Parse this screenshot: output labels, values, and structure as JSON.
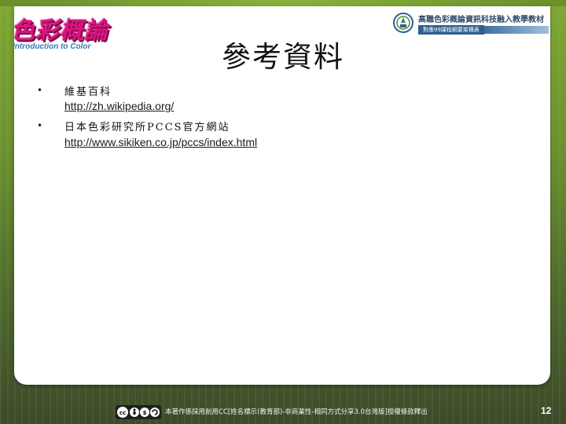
{
  "brand": {
    "logo_text": "色彩概論",
    "logo_subtitle": "Introduction to Color"
  },
  "header": {
    "title": "高職色彩概論資訊科技融入教學教材",
    "subtitle": "對應99課程綱要架構表"
  },
  "slide": {
    "title": "參考資料"
  },
  "references": [
    {
      "name": "維基百科",
      "url": "http://zh.wikipedia.org/"
    },
    {
      "name": "日本色彩研究所PCCS官方網站",
      "url": "http://www.sikiken.co.jp/pccs/index.html"
    }
  ],
  "footer": {
    "license_text": "本著作係採用創用CC[姓名標示(教育部)-非商業性-相同方式分享3.0台灣版]授權條款釋出",
    "cc_icon": "creative-commons-by-nc-sa-icon",
    "page_number": "12"
  },
  "colors": {
    "logo": "#d9147f",
    "header_blue": "#2e5f8f",
    "frame_green": "#6b9230"
  }
}
